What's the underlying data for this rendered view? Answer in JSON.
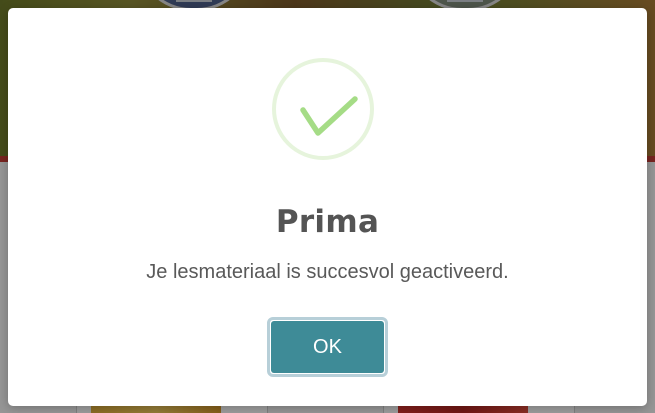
{
  "dialog": {
    "title": "Prima",
    "message": "Je lesmateriaal is succesvol geactiveerd.",
    "ok_label": "OK",
    "icon": "checkmark-icon"
  },
  "colors": {
    "checkmark": "#a5dc86",
    "icon_ring": "#e6f4dc",
    "button": "#3e8b97",
    "button_focus_ring": "#b7cfd8",
    "title": "#545454",
    "message": "#595959",
    "overlay": "rgba(0,0,0,0.38)"
  }
}
